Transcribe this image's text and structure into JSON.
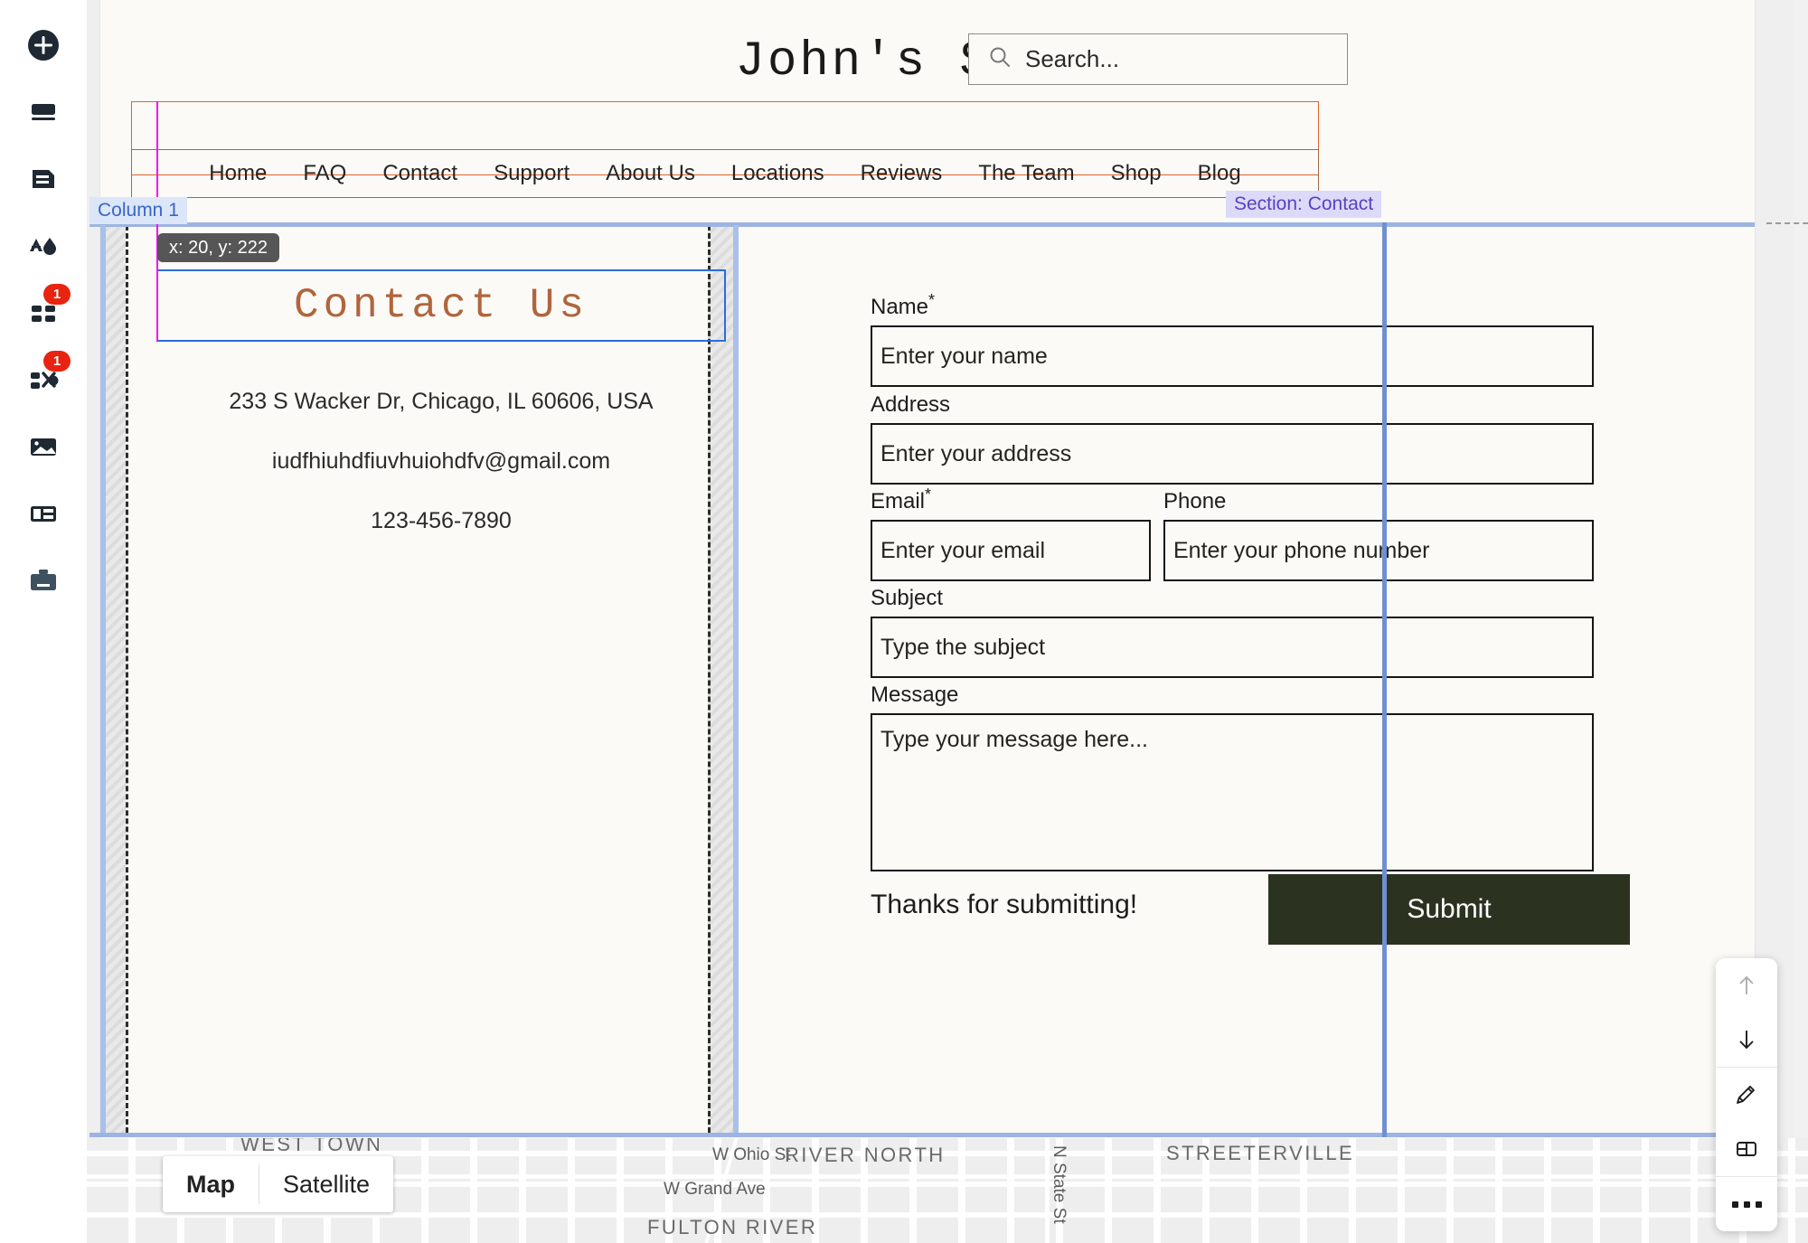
{
  "left_rail": {
    "items": [
      {
        "name": "add-icon",
        "label": "Add"
      },
      {
        "name": "pages-icon",
        "label": "Pages"
      },
      {
        "name": "document-icon",
        "label": "Content"
      },
      {
        "name": "theme-icon",
        "label": "Theme"
      },
      {
        "name": "apps-icon",
        "label": "Apps",
        "badge": "1"
      },
      {
        "name": "integrations-icon",
        "label": "Integrations",
        "badge": "1"
      },
      {
        "name": "media-icon",
        "label": "Media"
      },
      {
        "name": "layout-icon",
        "label": "Layout"
      },
      {
        "name": "business-icon",
        "label": "Business Tools"
      }
    ]
  },
  "site": {
    "title": "John's Shoes",
    "search": {
      "placeholder": "Search...",
      "icon": "search-icon"
    },
    "nav": [
      "Home",
      "FAQ",
      "Contact",
      "Support",
      "About Us",
      "Locations",
      "Reviews",
      "The Team",
      "Shop",
      "Blog"
    ]
  },
  "editor": {
    "column_chip": "Column 1",
    "section_chip": "Section: Contact",
    "coord_tooltip": "x: 20, y: 222",
    "selection_color": "#2b6cdc",
    "section_color": "#9db4e2",
    "nav_frame_color": "#e0622a",
    "guide_color": "#f312f3"
  },
  "contact": {
    "heading": "Contact Us",
    "heading_color": "#b0653c",
    "address": "233 S Wacker Dr, Chicago, IL 60606, USA",
    "email": "iudfhiuhdfiuvhuiohdfv@gmail.com",
    "phone": "123-456-7890"
  },
  "form": {
    "fields": [
      {
        "label": "Name",
        "required": "*",
        "placeholder": "Enter your name"
      },
      {
        "label": "Address",
        "required": "",
        "placeholder": "Enter your address"
      },
      {
        "label": "Email",
        "required": "*",
        "placeholder": "Enter your email"
      },
      {
        "label": "Phone",
        "required": "",
        "placeholder": "Enter your phone number"
      },
      {
        "label": "Subject",
        "required": "",
        "placeholder": "Type the subject"
      },
      {
        "label": "Message",
        "required": "",
        "placeholder": "Type your message here..."
      }
    ],
    "thanks_text": "Thanks for submitting!",
    "submit_label": "Submit",
    "submit_color": "#2b3320"
  },
  "map": {
    "toggle": {
      "map": "Map",
      "satellite": "Satellite",
      "active": "Map"
    },
    "labels": [
      "WEST TOWN",
      "W Ohio St",
      "RIVER NORTH",
      "N State St",
      "STREETERVILLE",
      "W Grand Ave",
      "FULTON RIVER"
    ]
  },
  "float_toolbar": {
    "items": [
      {
        "name": "move-up-icon",
        "label": "Move up",
        "disabled": true
      },
      {
        "name": "move-down-icon",
        "label": "Move down",
        "disabled": false
      },
      {
        "name": "edit-pencil-icon",
        "label": "Edit",
        "disabled": false
      },
      {
        "name": "layout-split-icon",
        "label": "Layout",
        "disabled": false
      },
      {
        "name": "more-options-icon",
        "label": "More",
        "disabled": false
      }
    ]
  }
}
